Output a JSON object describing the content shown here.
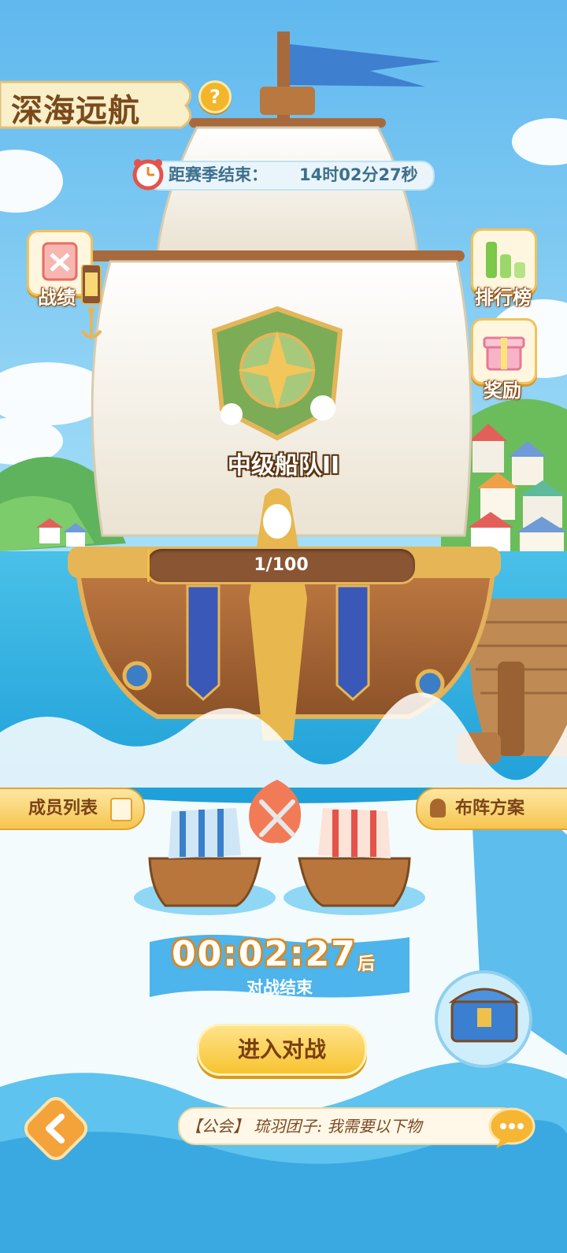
{
  "header": {
    "title": "深海远航",
    "help_label": "?"
  },
  "season_timer": {
    "label": "距赛季结束：",
    "value": "14时02分27秒"
  },
  "side_buttons": {
    "record": {
      "label": "战绩",
      "icon": "record-icon"
    },
    "leaderboard": {
      "label": "排行榜",
      "icon": "bar-chart-icon"
    },
    "rewards": {
      "label": "奖励",
      "icon": "gift-icon"
    }
  },
  "fleet": {
    "rank_name": "中级船队II",
    "progress_text": "1/100",
    "progress_fraction": 0.01
  },
  "battle": {
    "member_list_label": "成员列表",
    "formation_label": "布阵方案",
    "countdown": "00:02:27",
    "countdown_suffix": "后",
    "countdown_caption": "对战结束",
    "enter_button": "进入对战"
  },
  "chat": {
    "message": "【公会】 琉羽团子: 我需要以下物"
  },
  "colors": {
    "sky": "#7cc9f2",
    "sea": "#3bb0e0",
    "gold": "#f3c043",
    "wood": "#a86a3c"
  }
}
